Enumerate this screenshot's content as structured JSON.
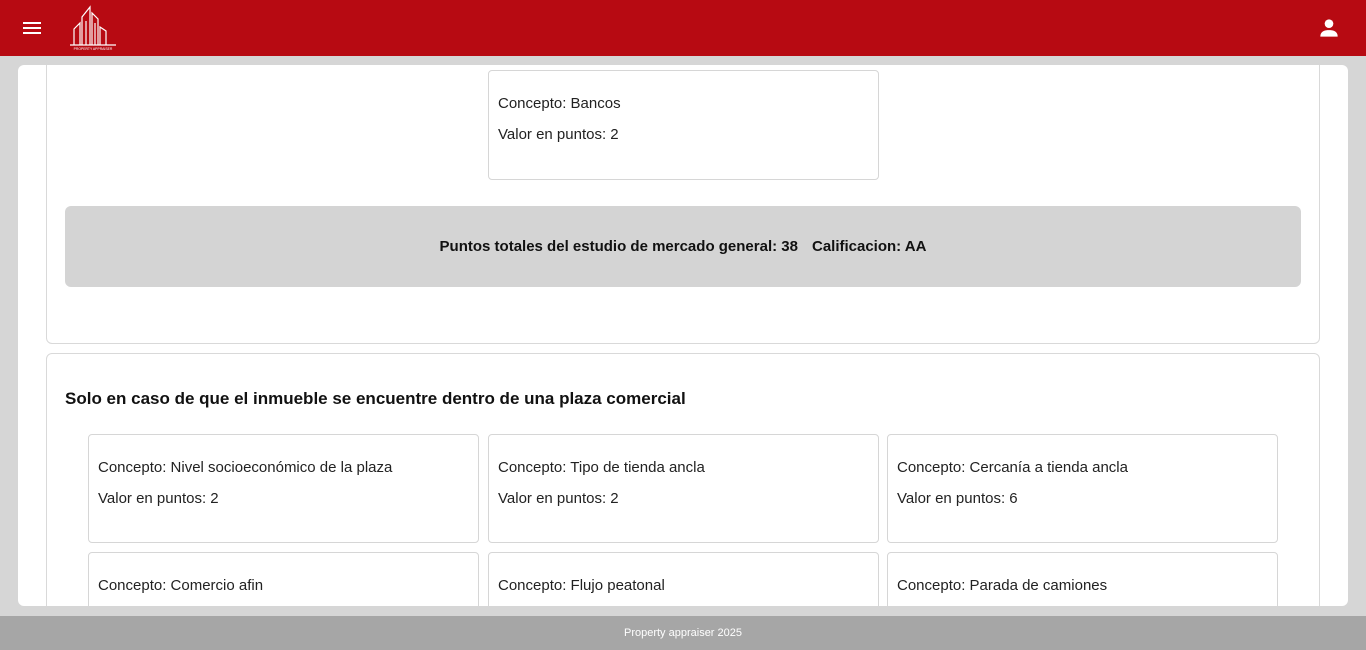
{
  "topbar": {
    "menu_icon": "menu-icon",
    "logo_text": "PROPERTY APPRAISER",
    "user_icon": "person-icon",
    "brand_color": "#b70a12"
  },
  "market_study": {
    "bank_card": {
      "concept": "Concepto: Bancos",
      "points": "Valor en puntos: 2"
    },
    "totals": {
      "total_label": "Puntos totales del estudio de mercado general: 38",
      "rating_label": "Calificacion: AA"
    }
  },
  "plaza_section": {
    "title": "Solo en caso de que el inmueble se encuentre dentro de una plaza comercial",
    "cards": [
      {
        "concept": "Concepto: Nivel socioeconómico de la plaza",
        "points": "Valor en puntos: 2"
      },
      {
        "concept": "Concepto: Tipo de tienda ancla",
        "points": "Valor en puntos: 2"
      },
      {
        "concept": "Concepto: Cercanía a tienda ancla",
        "points": "Valor en puntos: 6"
      },
      {
        "concept": "Concepto: Comercio afin",
        "points": ""
      },
      {
        "concept": "Concepto: Flujo peatonal",
        "points": ""
      },
      {
        "concept": "Concepto: Parada de camiones",
        "points": ""
      }
    ]
  },
  "footer": {
    "text": "Property appraiser 2025"
  }
}
